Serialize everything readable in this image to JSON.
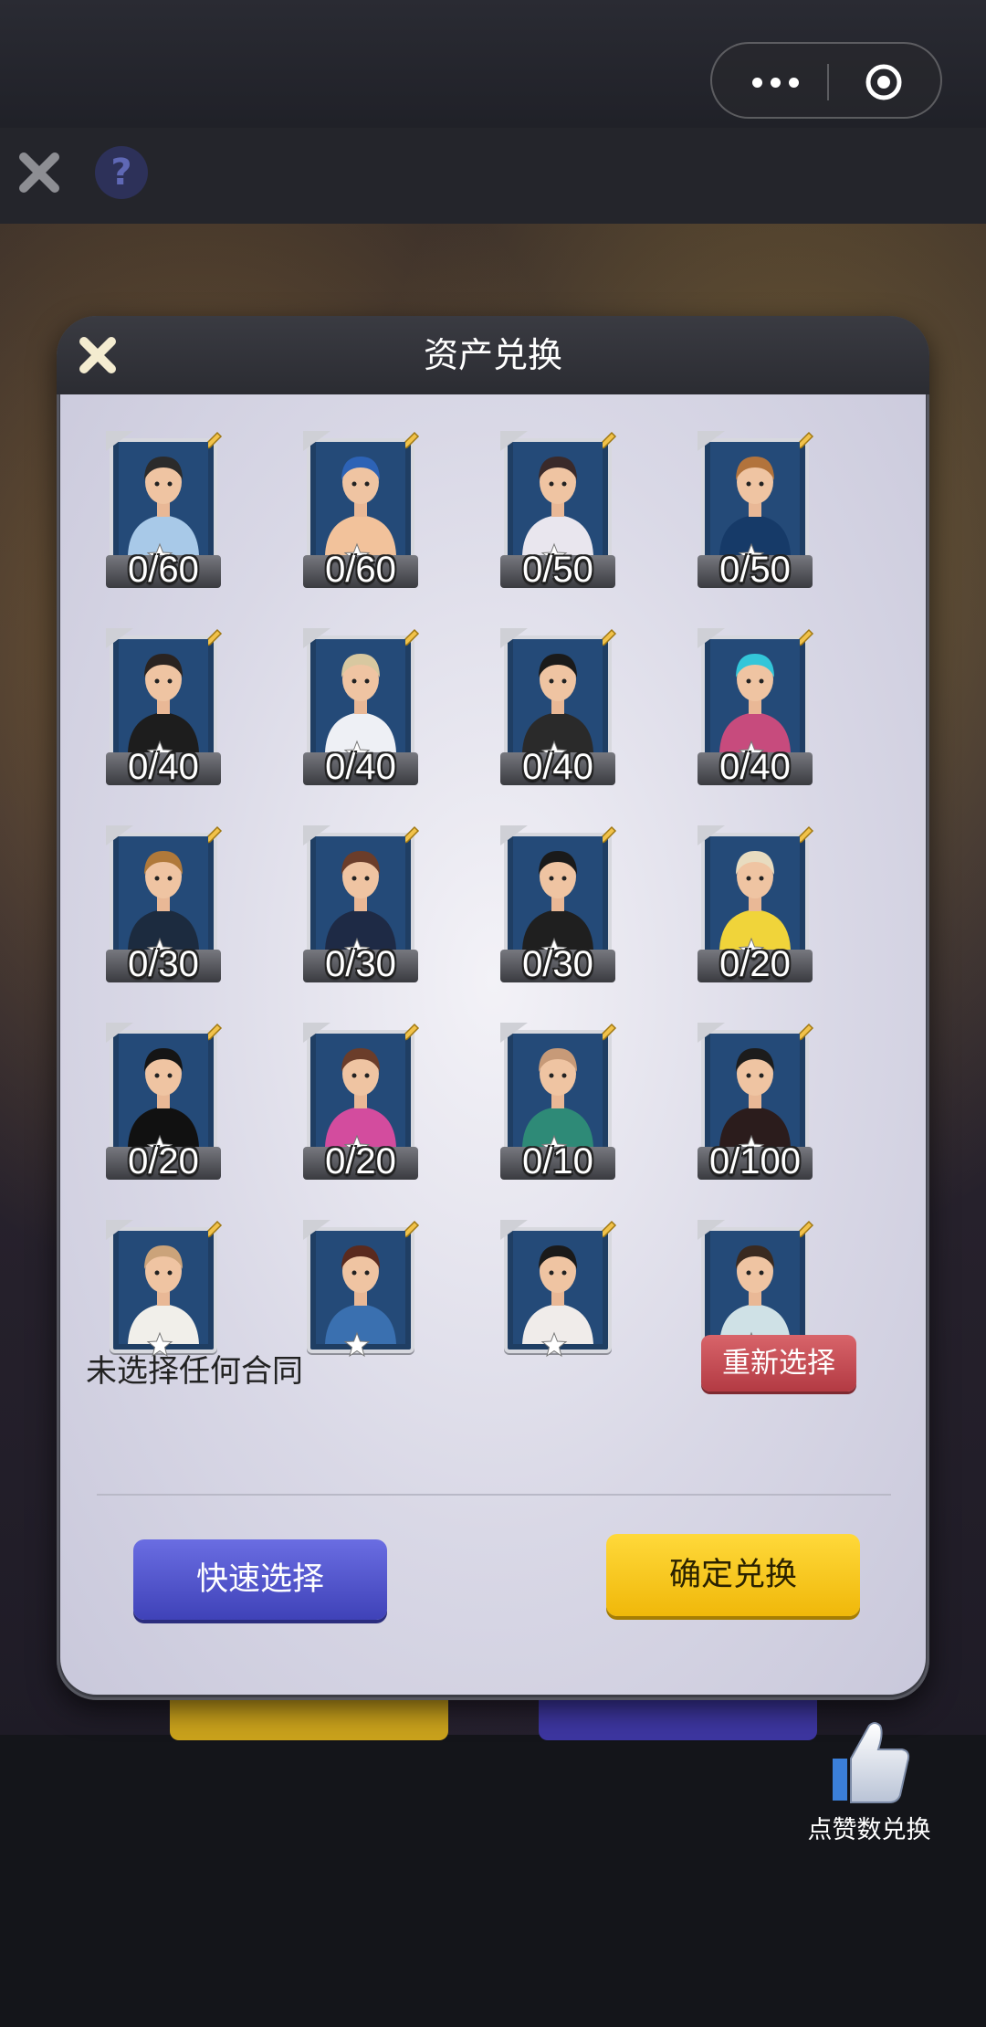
{
  "capsule": {
    "menu_icon": "more-dots-icon",
    "close_icon": "target-circle-icon"
  },
  "game_bar": {
    "close_icon": "close-x-icon",
    "help_label": "?"
  },
  "dialog": {
    "title": "资产兑换",
    "close_icon": "close-x-icon",
    "cards": [
      {
        "count": "0/60"
      },
      {
        "count": "0/60"
      },
      {
        "count": "0/50"
      },
      {
        "count": "0/50"
      },
      {
        "count": "0/40"
      },
      {
        "count": "0/40"
      },
      {
        "count": "0/40"
      },
      {
        "count": "0/40"
      },
      {
        "count": "0/30"
      },
      {
        "count": "0/30"
      },
      {
        "count": "0/30"
      },
      {
        "count": "0/20"
      },
      {
        "count": "0/20"
      },
      {
        "count": "0/20"
      },
      {
        "count": "0/10"
      },
      {
        "count": "0/100"
      },
      {
        "count": ""
      },
      {
        "count": ""
      },
      {
        "count": ""
      },
      {
        "count": ""
      }
    ],
    "status_text": "未选择任何合同",
    "reselect_label": "重新选择",
    "quick_select_label": "快速选择",
    "confirm_label": "确定兑换"
  },
  "like_exchange": {
    "icon": "thumbs-up-icon",
    "label": "点赞数兑换"
  },
  "colors": {
    "card_bg": "#1f3e63",
    "reselect": "#c4474f",
    "quick": "#5053cc",
    "confirm": "#f8c81c"
  }
}
